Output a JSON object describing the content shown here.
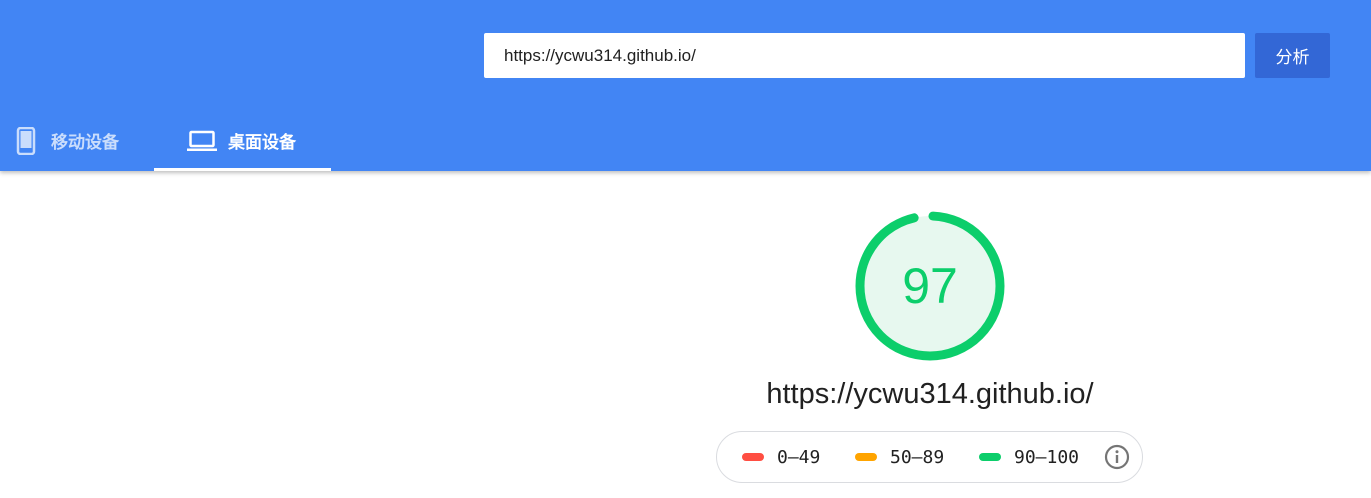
{
  "search": {
    "url_value": "https://ycwu314.github.io/",
    "analyze_label": "分析"
  },
  "tabs": [
    {
      "label": "移动设备",
      "icon": "smartphone-icon",
      "active": false
    },
    {
      "label": "桌面设备",
      "icon": "laptop-icon",
      "active": true
    }
  ],
  "report": {
    "score": "97",
    "score_fraction": 0.97,
    "url": "https://ycwu314.github.io/"
  },
  "legend": {
    "items": [
      {
        "label": "0–49",
        "color": "#ff4e42"
      },
      {
        "label": "50–89",
        "color": "#ffa400"
      },
      {
        "label": "90–100",
        "color": "#0cce6b"
      }
    ],
    "info_icon": "info-icon"
  },
  "colors": {
    "header_bg": "#4285f4",
    "button_bg": "#3367d6",
    "pass_green": "#0cce6b",
    "gauge_fill": "#e7f8ef"
  }
}
